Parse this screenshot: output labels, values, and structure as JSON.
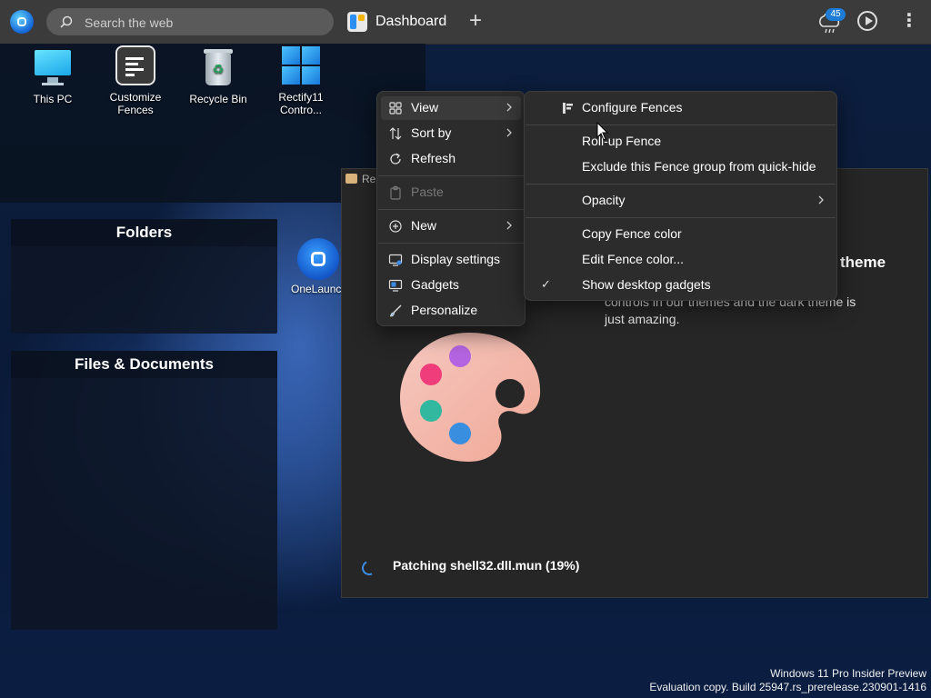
{
  "topbar": {
    "search_placeholder": "Search the web",
    "tab_label": "Dashboard",
    "plus_label": "+",
    "weather_badge": "45",
    "more_label": "⋮"
  },
  "desktop_icons": [
    {
      "label": "This PC"
    },
    {
      "label": "Customize Fences"
    },
    {
      "label": "Recycle Bin"
    },
    {
      "label": "Rectify11 Contro..."
    }
  ],
  "fences": {
    "folders_title": "Folders",
    "files_title": "Files & Documents"
  },
  "onelaunch_label": "OneLaunch",
  "rectify_window": {
    "title": "Re",
    "heading": "theme",
    "description": "controls in our themes and the dark theme is just amazing.",
    "status": "Patching shell32.dll.mun (19%)"
  },
  "context_menu": {
    "view": "View",
    "sort_by": "Sort by",
    "refresh": "Refresh",
    "paste": "Paste",
    "new": "New",
    "display_settings": "Display settings",
    "gadgets": "Gadgets",
    "personalize": "Personalize"
  },
  "submenu": {
    "configure_fences": "Configure Fences",
    "rollup_fence": "Roll-up Fence",
    "exclude_quickhide": "Exclude this Fence group from quick-hide",
    "opacity": "Opacity",
    "copy_color": "Copy Fence color",
    "edit_color": "Edit Fence color...",
    "show_gadgets": "Show desktop gadgets",
    "check_mark": "✓"
  },
  "watermark": {
    "line1": "Windows 11 Pro Insider Preview",
    "line2": "Evaluation copy. Build 25947.rs_prerelease.230901-1416"
  },
  "colors": {
    "topbar": "#3b3b3b",
    "menu_bg": "#2c2c2c",
    "accent": "#1e7cd6"
  }
}
